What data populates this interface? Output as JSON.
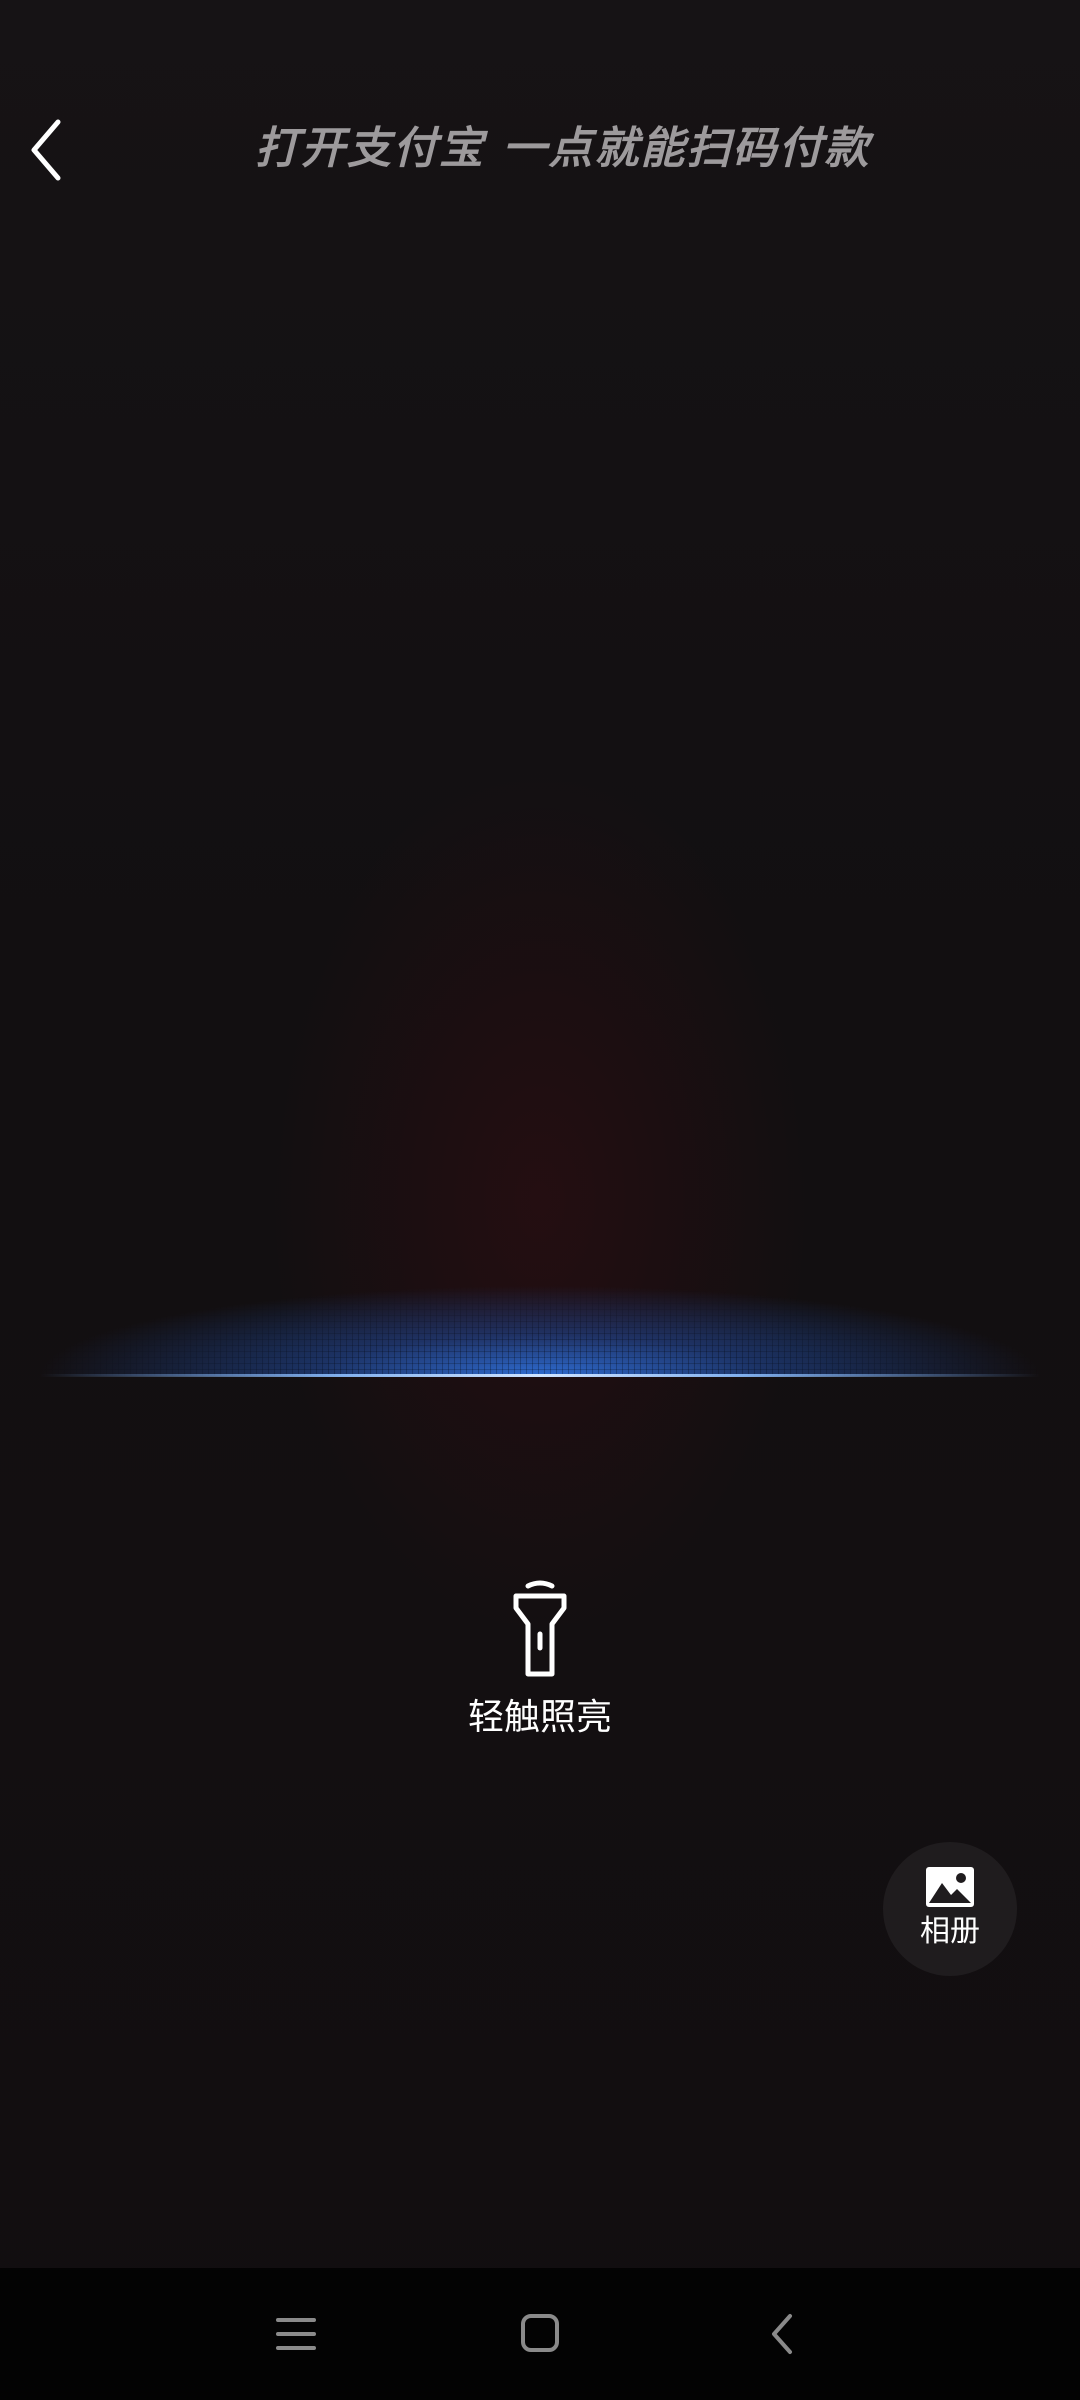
{
  "header": {
    "back_icon": "chevron-left-icon",
    "slogan": "打开支付宝 一点就能扫码付款"
  },
  "scanner": {
    "scan_line_color": "#2e70dc"
  },
  "torch": {
    "icon": "flashlight-icon",
    "label": "轻触照亮"
  },
  "album": {
    "icon": "image-icon",
    "label": "相册"
  },
  "navigation": {
    "items": [
      {
        "icon": "menu-icon"
      },
      {
        "icon": "home-square-icon"
      },
      {
        "icon": "back-chevron-icon"
      }
    ]
  }
}
